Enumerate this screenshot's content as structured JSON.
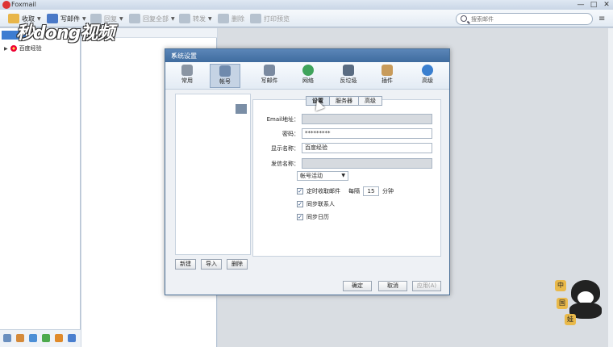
{
  "app": {
    "title": "Foxmail"
  },
  "toolbar": {
    "receive": "收取",
    "compose": "写邮件",
    "reply": "回复",
    "reply_all": "回复全部",
    "forward": "转发",
    "delete": "删除",
    "print_preview": "打印预览",
    "search_placeholder": "搜索邮件"
  },
  "left": {
    "account_name": "百度经验"
  },
  "watermark": "秒dong视频",
  "dialog": {
    "title": "系统设置",
    "nav": [
      "常用",
      "帐号",
      "写邮件",
      "网络",
      "反垃圾",
      "插件",
      "高级"
    ],
    "subtabs": [
      "设置",
      "服务器",
      "高级"
    ],
    "fields": {
      "email_label": "Email地址：",
      "email_value": "",
      "password_label": "密码：",
      "password_value": "*********",
      "display_name_label": "显示名称：",
      "display_name_value": "百度经验",
      "sender_name_label": "发信名称：",
      "sender_name_value": ""
    },
    "account_status": "帐号活动",
    "options": {
      "timed_receive": "定时收取邮件",
      "every": "每隔",
      "interval": "15",
      "minutes": "分钟",
      "sync_contacts": "同步联系人",
      "sync_calendar": "同步日历"
    },
    "account_buttons": {
      "new": "新建",
      "import": "导入",
      "delete": "删除"
    },
    "footer": {
      "ok": "确定",
      "cancel": "取消",
      "apply": "应用(A)"
    }
  },
  "mascot": {
    "badges": [
      "中",
      "国",
      "娃"
    ]
  },
  "colors": {
    "dialog_title": "#4a78ab",
    "selected_account": "#3d7cd1"
  }
}
